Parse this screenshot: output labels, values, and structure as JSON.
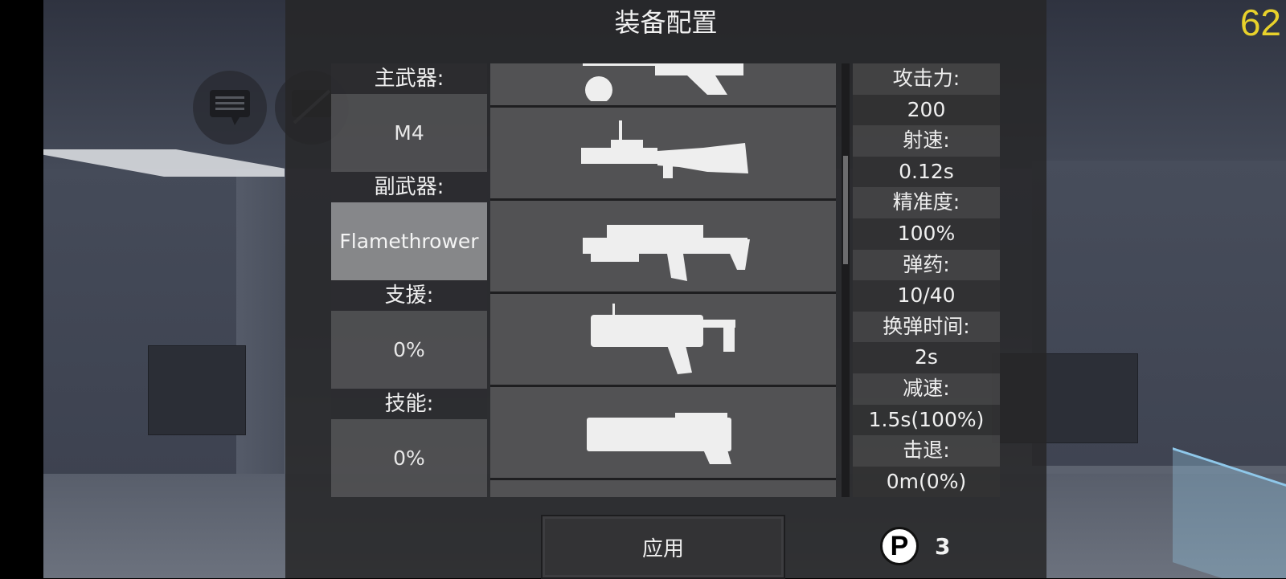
{
  "hud": {
    "fps": "62"
  },
  "dialog": {
    "title": "装备配置",
    "slots": [
      {
        "label": "主武器:",
        "value": "M4",
        "selected": false
      },
      {
        "label": "副武器:",
        "value": "Flamethrower",
        "selected": true
      },
      {
        "label": "支援:",
        "value": "0%",
        "selected": false
      },
      {
        "label": "技能:",
        "value": "0%",
        "selected": false
      }
    ],
    "weapons": [
      "rifle-scoped-icon",
      "light-machine-gun-icon",
      "heavy-rifle-icon",
      "grenade-launcher-icon",
      "flamethrower-icon"
    ],
    "stats": [
      {
        "label": "攻击力:",
        "value": "200"
      },
      {
        "label": "射速:",
        "value": "0.12s"
      },
      {
        "label": "精准度:",
        "value": "100%"
      },
      {
        "label": "弹药:",
        "value": "10/40"
      },
      {
        "label": "换弹时间:",
        "value": "2s"
      },
      {
        "label": "减速:",
        "value": "1.5s(100%)"
      },
      {
        "label": "击退:",
        "value": "0m(0%)"
      }
    ],
    "apply_label": "应用",
    "points": {
      "icon": "P",
      "count": "3"
    }
  }
}
